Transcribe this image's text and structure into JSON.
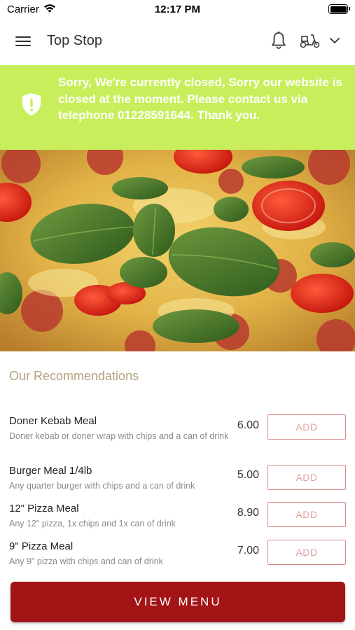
{
  "status_bar": {
    "carrier": "Carrier",
    "time": "12:17 PM"
  },
  "header": {
    "title": "Top Stop",
    "icons": [
      "menu-icon",
      "bell-icon",
      "scooter-icon",
      "chevron-down-icon"
    ]
  },
  "banner": {
    "message": "Sorry, We're currently closed, Sorry our website is closed at the moment. Please contact us via telephone 01228591644. Thank you.",
    "background": "#c9ee5b",
    "icon": "shield-alert-icon"
  },
  "hero": {
    "description_icon": "pizza-photo"
  },
  "recommendations": {
    "title": "Our Recommendations",
    "items": [
      {
        "name": "Doner Kebab Meal",
        "description": "Doner kebab or doner wrap with chips and a can of drink",
        "price": "6.00",
        "add_label": "ADD"
      },
      {
        "name": "Burger Meal 1/4lb",
        "description": "Any quarter burger with chips and a can of drink",
        "price": "5.00",
        "add_label": "ADD"
      },
      {
        "name": "12\" Pizza Meal",
        "description": "Any 12\" pizza, 1x chips and 1x can of drink",
        "price": "8.90",
        "add_label": "ADD"
      },
      {
        "name": "9\" Pizza Meal",
        "description": "Any 9\" pizza with chips and can of drink",
        "price": "7.00",
        "add_label": "ADD"
      }
    ]
  },
  "footer": {
    "view_menu_label": "VIEW MENU",
    "accent": "#a31417"
  }
}
